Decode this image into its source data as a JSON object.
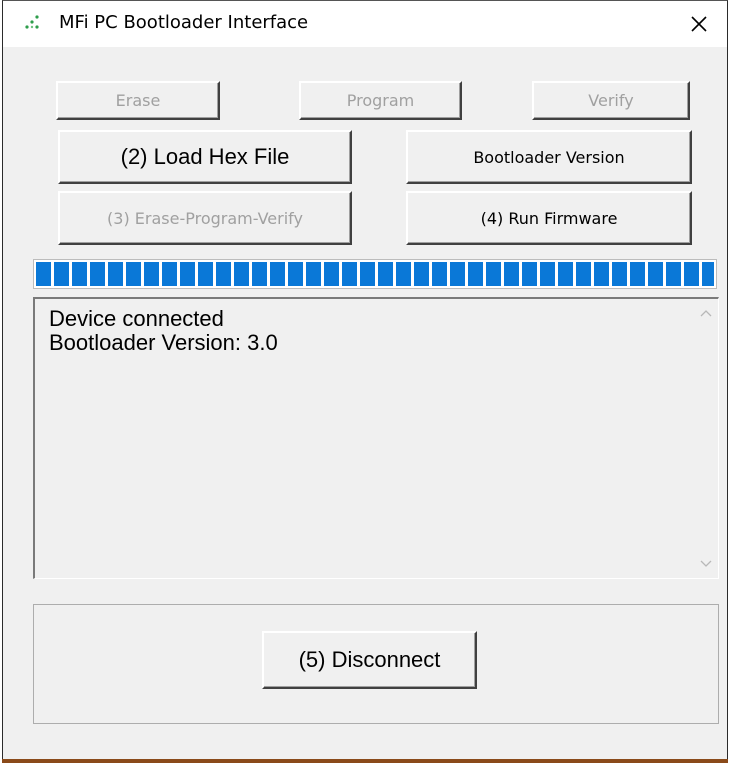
{
  "window": {
    "title": "MFi PC Bootloader Interface"
  },
  "buttons": {
    "erase": "Erase",
    "program": "Program",
    "verify": "Verify",
    "load_hex": "(2) Load Hex File",
    "bootloader_version": "Bootloader Version",
    "erase_program_verify": "(3) Erase-Program-Verify",
    "run_firmware": "(4) Run Firmware",
    "disconnect": "(5) Disconnect"
  },
  "progress": {
    "value_percent": 100,
    "color": "#0a78d7"
  },
  "log": {
    "lines": [
      "Device connected",
      "Bootloader Version: 3.0"
    ]
  },
  "icons": {
    "app": "app-dots-icon",
    "close": "close-icon",
    "scroll_up": "chevron-up-icon",
    "scroll_down": "chevron-down-icon"
  }
}
